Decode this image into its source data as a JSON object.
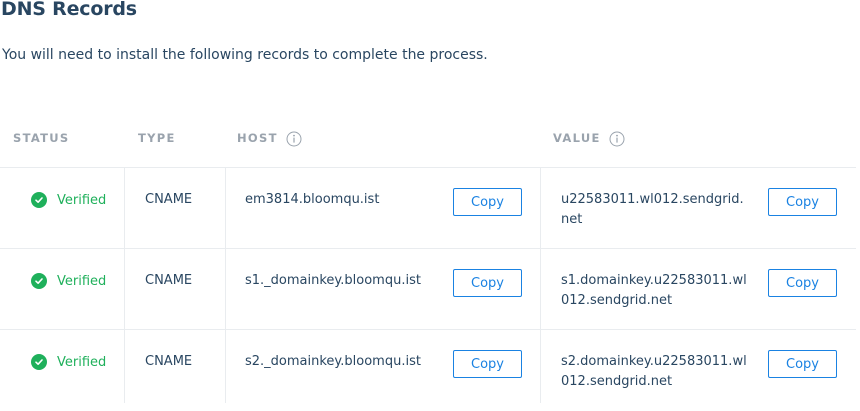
{
  "header": {
    "title": "DNS Records",
    "description": "You will need to install the following records to complete the process."
  },
  "table": {
    "columns": {
      "status": "STATUS",
      "type": "TYPE",
      "host": "HOST",
      "value": "VALUE"
    },
    "rows": [
      {
        "status": "Verified",
        "type": "CNAME",
        "host": "em3814.bloomqu.ist",
        "value": "u22583011.wl012.sendgrid.net",
        "copy_host_label": "Copy",
        "copy_value_label": "Copy"
      },
      {
        "status": "Verified",
        "type": "CNAME",
        "host": "s1._domainkey.bloomqu.ist",
        "value": "s1.domainkey.u22583011.wl012.sendgrid.net",
        "copy_host_label": "Copy",
        "copy_value_label": "Copy"
      },
      {
        "status": "Verified",
        "type": "CNAME",
        "host": "s2._domainkey.bloomqu.ist",
        "value": "s2.domainkey.u22583011.wl012.sendgrid.net",
        "copy_host_label": "Copy",
        "copy_value_label": "Copy"
      }
    ]
  },
  "icons": {
    "info": "info-icon",
    "verified": "check-circle-icon"
  },
  "colors": {
    "text": "#294661",
    "header_text": "#9aa3ad",
    "verified": "#1fb05b",
    "button": "#1a82e2",
    "border": "#e9ecef"
  }
}
